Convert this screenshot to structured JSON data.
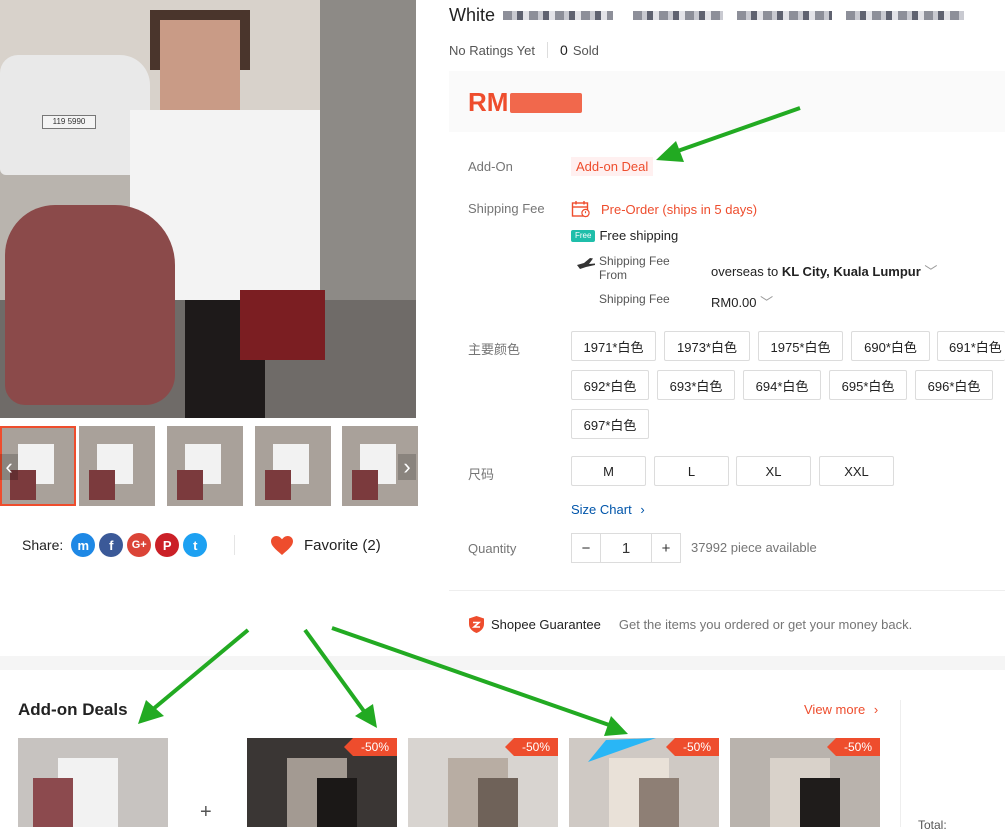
{
  "product": {
    "title_prefix": "White",
    "ratings_text": "No Ratings Yet",
    "sold_count": "0",
    "sold_label": "Sold",
    "price_prefix": "RM"
  },
  "gallery": {
    "plate_text": "119 5990",
    "prev_glyph": "‹",
    "next_glyph": "›",
    "thumbnail_count": 5
  },
  "share": {
    "label": "Share:",
    "networks": [
      {
        "name": "messenger",
        "glyph": "m",
        "color": "#1e88e5"
      },
      {
        "name": "facebook",
        "glyph": "f",
        "color": "#3b5998"
      },
      {
        "name": "google-plus",
        "glyph": "G+",
        "color": "#db4437"
      },
      {
        "name": "pinterest",
        "glyph": "P",
        "color": "#cb2027"
      },
      {
        "name": "twitter",
        "glyph": "t",
        "color": "#1da1f2"
      }
    ]
  },
  "favorite": {
    "label": "Favorite (2)",
    "icon": "heart-icon",
    "color": "#ee4d2d"
  },
  "addon": {
    "label": "Add-On",
    "chip": "Add-on Deal"
  },
  "shipping": {
    "label": "Shipping Fee",
    "preorder": "Pre-Order (ships in 5 days)",
    "free_badge": "Free",
    "free_text": "Free shipping",
    "from_label": "Shipping Fee From",
    "from_value": "overseas",
    "to_word": "to",
    "to_value": "KL City, Kuala Lumpur",
    "fee_label": "Shipping Fee",
    "fee_value": "RM0.00"
  },
  "variation": {
    "label": "主要颜色",
    "options": [
      "1971*白色",
      "1973*白色",
      "1975*白色",
      "690*白色",
      "691*白色",
      "692*白色",
      "693*白色",
      "694*白色",
      "695*白色",
      "696*白色",
      "697*白色"
    ]
  },
  "size": {
    "label": "尺码",
    "options": [
      "M",
      "L",
      "XL",
      "XXL"
    ],
    "chart_link": "Size Chart"
  },
  "quantity": {
    "label": "Quantity",
    "minus": "−",
    "value": "1",
    "plus": "+",
    "available": "37992 piece available"
  },
  "guarantee": {
    "title": "Shopee Guarantee",
    "text": "Get the items you ordered or get your money back."
  },
  "addon_deals": {
    "title": "Add-on Deals",
    "view_more": "View more",
    "plus": "+",
    "discount_badge": "-50%",
    "total_label": "Total:"
  },
  "colors": {
    "accent": "#ee4d2d",
    "link": "#0055aa",
    "annotation_arrow": "#22aa22",
    "annotation_blue": "#29b6f6"
  }
}
